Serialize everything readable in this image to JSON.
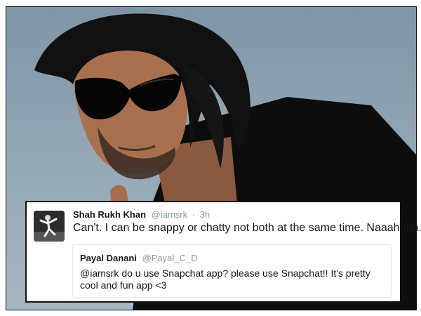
{
  "tweet": {
    "author_name": "Shah Rukh Khan",
    "author_handle": "@iamsrk",
    "separator": "·",
    "time": "3h",
    "text": "Can't. I can be snappy or chatty not both at the same time. Naaahhhh...",
    "avatar_icon": "profile-photo-icon"
  },
  "quoted_tweet": {
    "author_name": "Payal Danani",
    "author_handle": "@Payal_C_D",
    "text": "@iamsrk do u use Snapchat app? please use Snapchat!! It's pretty cool and fun app <3"
  },
  "colors": {
    "text_primary": "#14171a",
    "text_secondary": "#8899a6",
    "quote_border": "#e1e8ed",
    "card_border": "#111111"
  }
}
